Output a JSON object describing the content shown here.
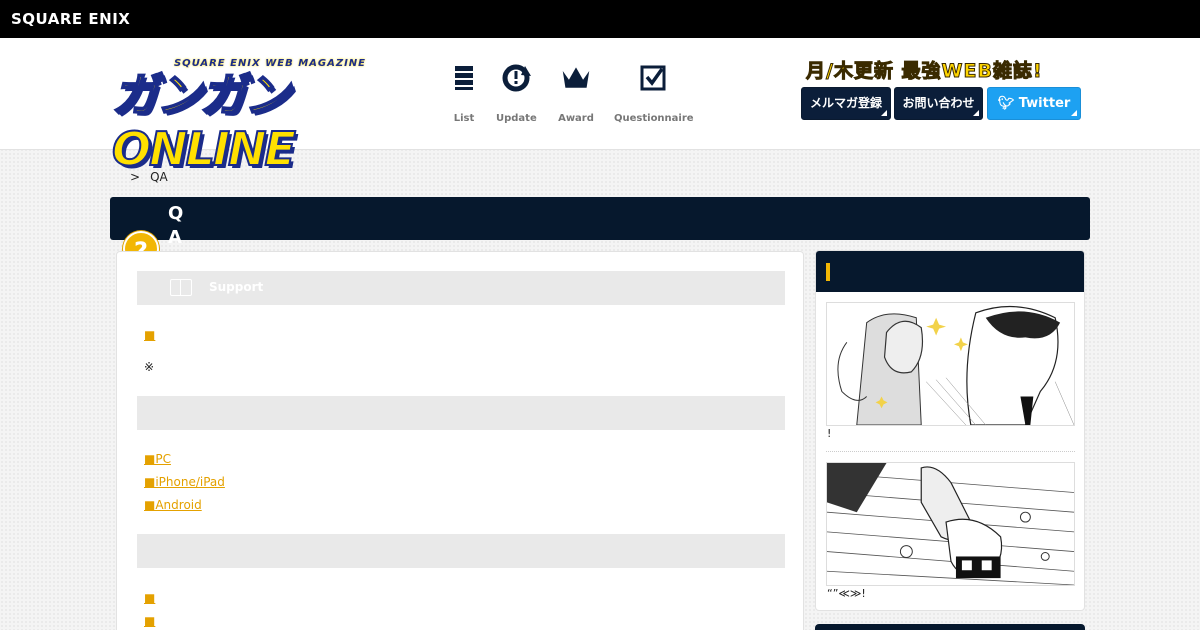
{
  "corp": {
    "logo": "SQUARE ENIX"
  },
  "header": {
    "logo_sub": "SQUARE ENIX WEB MAGAZINE",
    "logo_main": "ガンガンONLINE",
    "nav": [
      {
        "label": "List",
        "icon": "list-icon"
      },
      {
        "label": "Update",
        "icon": "update-icon"
      },
      {
        "label": "Award",
        "icon": "crown-icon"
      },
      {
        "label": "Questionnaire",
        "icon": "checkbox-icon"
      }
    ],
    "tagline": "月/木更新 最強WEB雑誌!",
    "buttons": {
      "mail": "メルマガ登録",
      "contact": "お問い合わせ",
      "twitter": "Twitter"
    }
  },
  "breadcrumb": {
    "separator": ">",
    "current": "QA"
  },
  "title": {
    "q": "Q",
    "a": "A",
    "badge": "?"
  },
  "main": {
    "sections": [
      {
        "label": "Support",
        "icon": "book-icon"
      },
      {
        "label": ""
      },
      {
        "label": ""
      }
    ],
    "links_1": [
      "■"
    ],
    "note": "※",
    "links_2": [
      "■PC",
      "■iPhone/iPad",
      "■Android"
    ],
    "links_3": [
      "■",
      "■"
    ]
  },
  "sidebar": {
    "captions": [
      "!",
      "“”≪≫!"
    ]
  },
  "colors": {
    "navy": "#06182d",
    "accent": "#f2b705",
    "link": "#e4a100",
    "twitter": "#1da1f2"
  }
}
